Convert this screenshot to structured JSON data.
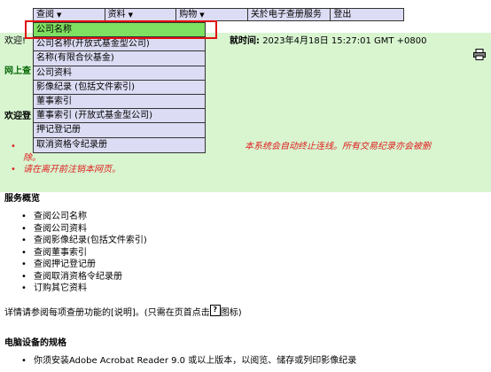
{
  "top_menu": [
    {
      "label": "查阅",
      "dropdown": true
    },
    {
      "label": "资料",
      "dropdown": true
    },
    {
      "label": "购物",
      "dropdown": true
    },
    {
      "label": "关於电子查册服务",
      "dropdown": false
    },
    {
      "label": "登出",
      "dropdown": false
    }
  ],
  "dropdown_items": [
    {
      "label": "公司名称",
      "active": true
    },
    {
      "label": "公司名称(开放式基金型公司)"
    },
    {
      "label": "名称(有限合伙基金)"
    },
    {
      "label": "公司资料"
    },
    {
      "label": "影像纪录 (包括文件索引)"
    },
    {
      "label": "董事索引"
    },
    {
      "label": "董事索引 (开放式基金型公司)"
    },
    {
      "label": "押记登记册"
    },
    {
      "label": "取消资格令纪录册"
    }
  ],
  "header": {
    "welcome_text": "欢迎!",
    "login_time_label": "就时间:",
    "login_time_value": "2023年4月18日 15:27:01 GMT +0800",
    "online_heading": "网上查",
    "welcome_heading": "欢迎登"
  },
  "notices": {
    "item1": "本系统会自动终止连线。所有交易纪录亦会被删",
    "item1_cont": "除。",
    "item2": "请在离开前注销本网页。"
  },
  "service_overview": {
    "title": "服务概览",
    "items": [
      "查阅公司名称",
      "查阅公司资料",
      "查阅影像纪录(包括文件索引)",
      "查阅董事索引",
      "查阅押记登记册",
      "查阅取消资格令纪录册",
      "订购其它资料"
    ]
  },
  "detail_note": {
    "before": "详情请参阅每项查册功能的[说明]。(只需在页首点击",
    "after": "图标)",
    "icon": "help-icon"
  },
  "computer_spec": {
    "title": "电脑设备的规格",
    "items": [
      "你须安装Adobe Acrobat Reader 9.0 或以上版本，以阅览、储存或列印影像纪录"
    ]
  },
  "colors": {
    "content_bg": "#d8f5d0",
    "menu_bg": "#dcdcf4",
    "active_item": "#7ee060",
    "highlight": "#e01010",
    "notice_red": "#e02020"
  }
}
